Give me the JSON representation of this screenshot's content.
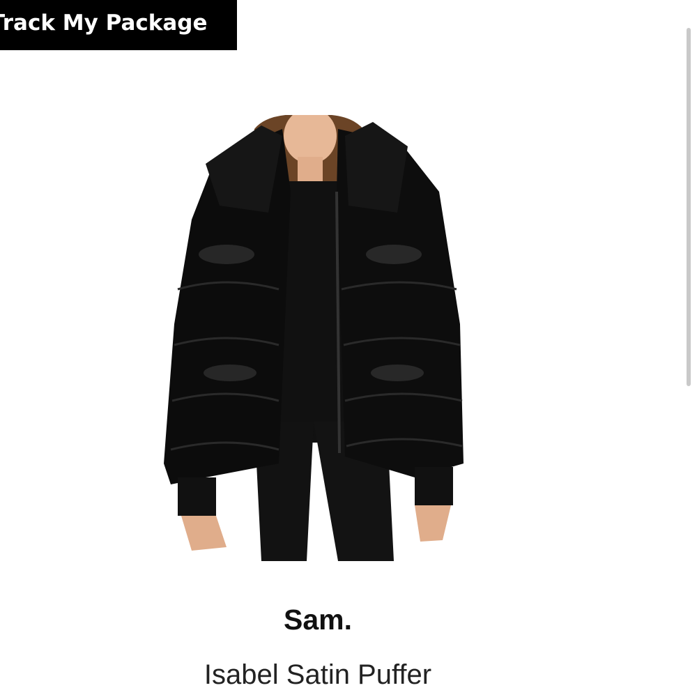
{
  "header": {
    "track_label": "Track My Package"
  },
  "product": {
    "brand": "Sam.",
    "name": "Isabel Satin Puffer",
    "image_icon": "product-photo-black-puffer-jacket"
  },
  "colors": {
    "button_bg": "#000000",
    "button_text": "#ffffff",
    "jacket": "#0c0c0c"
  }
}
